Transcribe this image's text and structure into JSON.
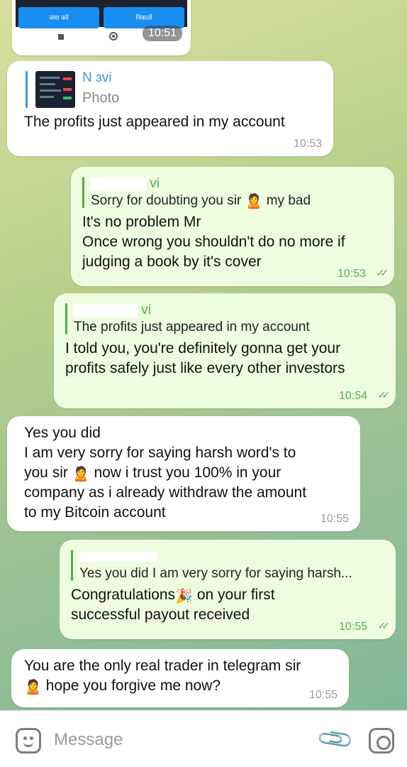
{
  "screenshot_message": {
    "button_deposit": "जमा करें",
    "button_withdraw": "निकालें",
    "time": "10:51"
  },
  "messages": [
    {
      "direction": "incoming",
      "reply_name": "N       ɜvi",
      "reply_sub": "Photo",
      "text": "The profits just appeared in my account",
      "time": "10:53"
    },
    {
      "direction": "outgoing",
      "reply_name": "vi",
      "reply_text": "Sorry for doubting you sir",
      "reply_text_after": "my bad",
      "text": "It's no problem Mr\nOnce wrong you shouldn't do no more if\njudging a book by it's cover",
      "time": "10:53",
      "status": "read"
    },
    {
      "direction": "outgoing",
      "reply_name": "vi",
      "reply_text": "The profits just appeared in my account",
      "text": "I told you, you're definitely gonna get your\nprofits safely just like every other investors",
      "time": "10:54",
      "status": "read"
    },
    {
      "direction": "incoming",
      "text_1": "Yes you did\nI am very sorry for saying harsh word's to\nyou sir",
      "text_2": " now i trust you 100% in your\ncompany as i already withdraw the amount\nto my Bitcoin account",
      "time": "10:55"
    },
    {
      "direction": "outgoing",
      "reply_name": "",
      "reply_text": "Yes you did I am very sorry for saying harsh...",
      "text_1": "Congratulations",
      "text_2": " on your first\nsuccessful payout received",
      "time": "10:55",
      "status": "read"
    },
    {
      "direction": "incoming",
      "text_1": "You are the only real trader in telegram sir",
      "text_2": " hope you forgive me now?",
      "time": "10:55"
    }
  ],
  "emojis": {
    "man_emoji": "🙎",
    "party_emoji": "🎉"
  },
  "composer": {
    "placeholder": "Message",
    "icons": [
      "emoji-icon",
      "attach-icon",
      "camera-icon"
    ]
  },
  "colors": {
    "incoming_bubble": "#ffffff",
    "outgoing_bubble": "#eefddf",
    "accent_blue": "#3d97d6",
    "accent_green": "#4fae4e"
  }
}
